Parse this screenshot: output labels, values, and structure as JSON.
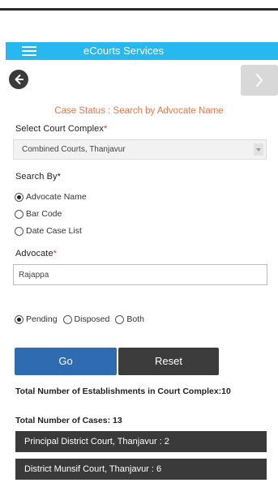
{
  "app": {
    "title": "eCourts Services"
  },
  "page": {
    "heading": "Case Status : Search by Advocate Name"
  },
  "court_complex": {
    "label": "Select Court Complex",
    "required_mark": "*",
    "selected": "Combined Courts, Thanjavur"
  },
  "search_by": {
    "label": "Search By*",
    "options": [
      "Advocate Name",
      "Bar Code",
      "Date Case List"
    ],
    "selected": "Advocate Name"
  },
  "advocate": {
    "label": "Advocate",
    "required_mark": "*",
    "value": "Rajappa"
  },
  "case_status": {
    "options": [
      "Pending",
      "Disposed",
      "Both"
    ],
    "selected": "Pending"
  },
  "buttons": {
    "go": "Go",
    "reset": "Reset"
  },
  "summary": {
    "establishments": "Total Number of Establishments in Court Complex:10",
    "cases": "Total Number of Cases: 13"
  },
  "results": [
    "Principal District Court, Thanjavur : 2",
    "District Munsif Court, Thanjavur : 6"
  ],
  "icons": {
    "menu": "hamburger-icon",
    "back": "arrow-left-icon",
    "forward": "arrow-right-icon"
  },
  "colors": {
    "appbar": "#27b8f0",
    "heading": "#e07a4e",
    "go_button": "#2f6bb0",
    "dark": "#3a3a3a"
  }
}
